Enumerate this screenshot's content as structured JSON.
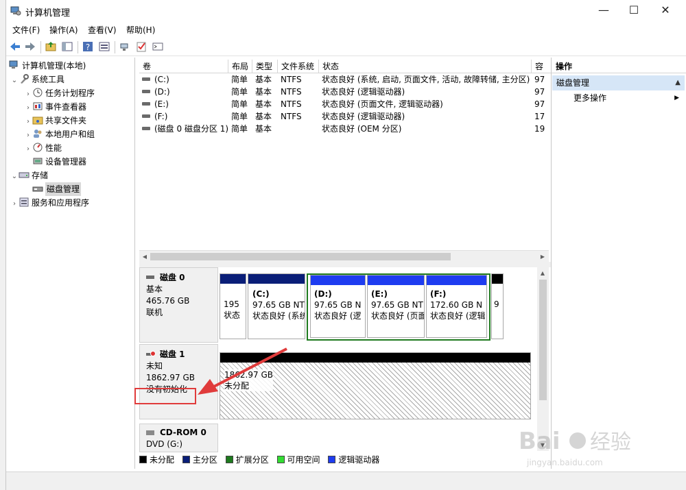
{
  "window": {
    "title": "计算机管理",
    "controls": {
      "minimize": "—",
      "maximize": "☐",
      "close": "✕"
    }
  },
  "menu": [
    "文件(F)",
    "操作(A)",
    "查看(V)",
    "帮助(H)"
  ],
  "toolbar": {
    "icons": [
      "back-arrow-icon",
      "forward-arrow-icon",
      "up-folder-icon",
      "show-hide-tree-icon",
      "help-icon",
      "properties-icon",
      "connect-icon",
      "check-icon",
      "console-icon"
    ]
  },
  "tree": {
    "root": "计算机管理(本地)",
    "system_tools": "系统工具",
    "task_scheduler": "任务计划程序",
    "event_viewer": "事件查看器",
    "shared_folders": "共享文件夹",
    "local_users": "本地用户和组",
    "performance": "性能",
    "device_manager": "设备管理器",
    "storage": "存储",
    "disk_management": "磁盘管理",
    "services_apps": "服务和应用程序"
  },
  "volumes": {
    "columns": [
      "卷",
      "布局",
      "类型",
      "文件系统",
      "状态",
      "容"
    ],
    "rows": [
      {
        "vol": "(C:)",
        "layout": "简单",
        "type": "基本",
        "fs": "NTFS",
        "status": "状态良好 (系统, 启动, 页面文件, 活动, 故障转储, 主分区)",
        "cap": "97"
      },
      {
        "vol": "(D:)",
        "layout": "简单",
        "type": "基本",
        "fs": "NTFS",
        "status": "状态良好 (逻辑驱动器)",
        "cap": "97"
      },
      {
        "vol": "(E:)",
        "layout": "简单",
        "type": "基本",
        "fs": "NTFS",
        "status": "状态良好 (页面文件, 逻辑驱动器)",
        "cap": "97"
      },
      {
        "vol": "(F:)",
        "layout": "简单",
        "type": "基本",
        "fs": "NTFS",
        "status": "状态良好 (逻辑驱动器)",
        "cap": "17"
      },
      {
        "vol": "(磁盘 0 磁盘分区 1)",
        "layout": "简单",
        "type": "基本",
        "fs": "",
        "status": "状态良好 (OEM 分区)",
        "cap": "19"
      }
    ]
  },
  "disks": {
    "disk0": {
      "name": "磁盘 0",
      "kind": "基本",
      "size": "465.76 GB",
      "state": "联机",
      "parts": {
        "p1": {
          "line1": "195",
          "line2": "状态"
        },
        "c": {
          "name": "(C:)",
          "line1": "97.65 GB NT",
          "line2": "状态良好 (系统"
        },
        "d": {
          "name": "(D:)",
          "line1": "97.65 GB N",
          "line2": "状态良好 (逻"
        },
        "e": {
          "name": "(E:)",
          "line1": "97.65 GB NT",
          "line2": "状态良好 (页面"
        },
        "f": {
          "name": "(F:)",
          "line1": "172.60 GB N",
          "line2": "状态良好 (逻辑"
        },
        "last": {
          "line1": "9"
        }
      }
    },
    "disk1": {
      "name": "磁盘 1",
      "kind": "未知",
      "size": "1862.97 GB",
      "state": "没有初始化",
      "unallocated": {
        "line1": "1862.97 GB",
        "line2": "未分配"
      }
    },
    "cdrom": {
      "name": "CD-ROM 0",
      "label": "DVD (G:)"
    }
  },
  "legend": [
    {
      "label": "未分配",
      "color": "#000000"
    },
    {
      "label": "主分区",
      "color": "#0a1e78"
    },
    {
      "label": "扩展分区",
      "color": "#1e7a1e"
    },
    {
      "label": "可用空间",
      "color": "#33dd33"
    },
    {
      "label": "逻辑驱动器",
      "color": "#1e3cf0"
    }
  ],
  "actions": {
    "title": "操作",
    "group": "磁盘管理",
    "more": "更多操作"
  },
  "colors": {
    "primary_bar": "#0a1e78",
    "logical_bar": "#1e3cf0",
    "extended_outline": "#1e7a1e",
    "unallocated_bar": "#000000",
    "annotation": "#e03b3b",
    "selection": "#d6e6f7"
  },
  "watermark": {
    "brand": "Baidu",
    "cn": "经验",
    "url": "jingyan.baidu.com"
  }
}
